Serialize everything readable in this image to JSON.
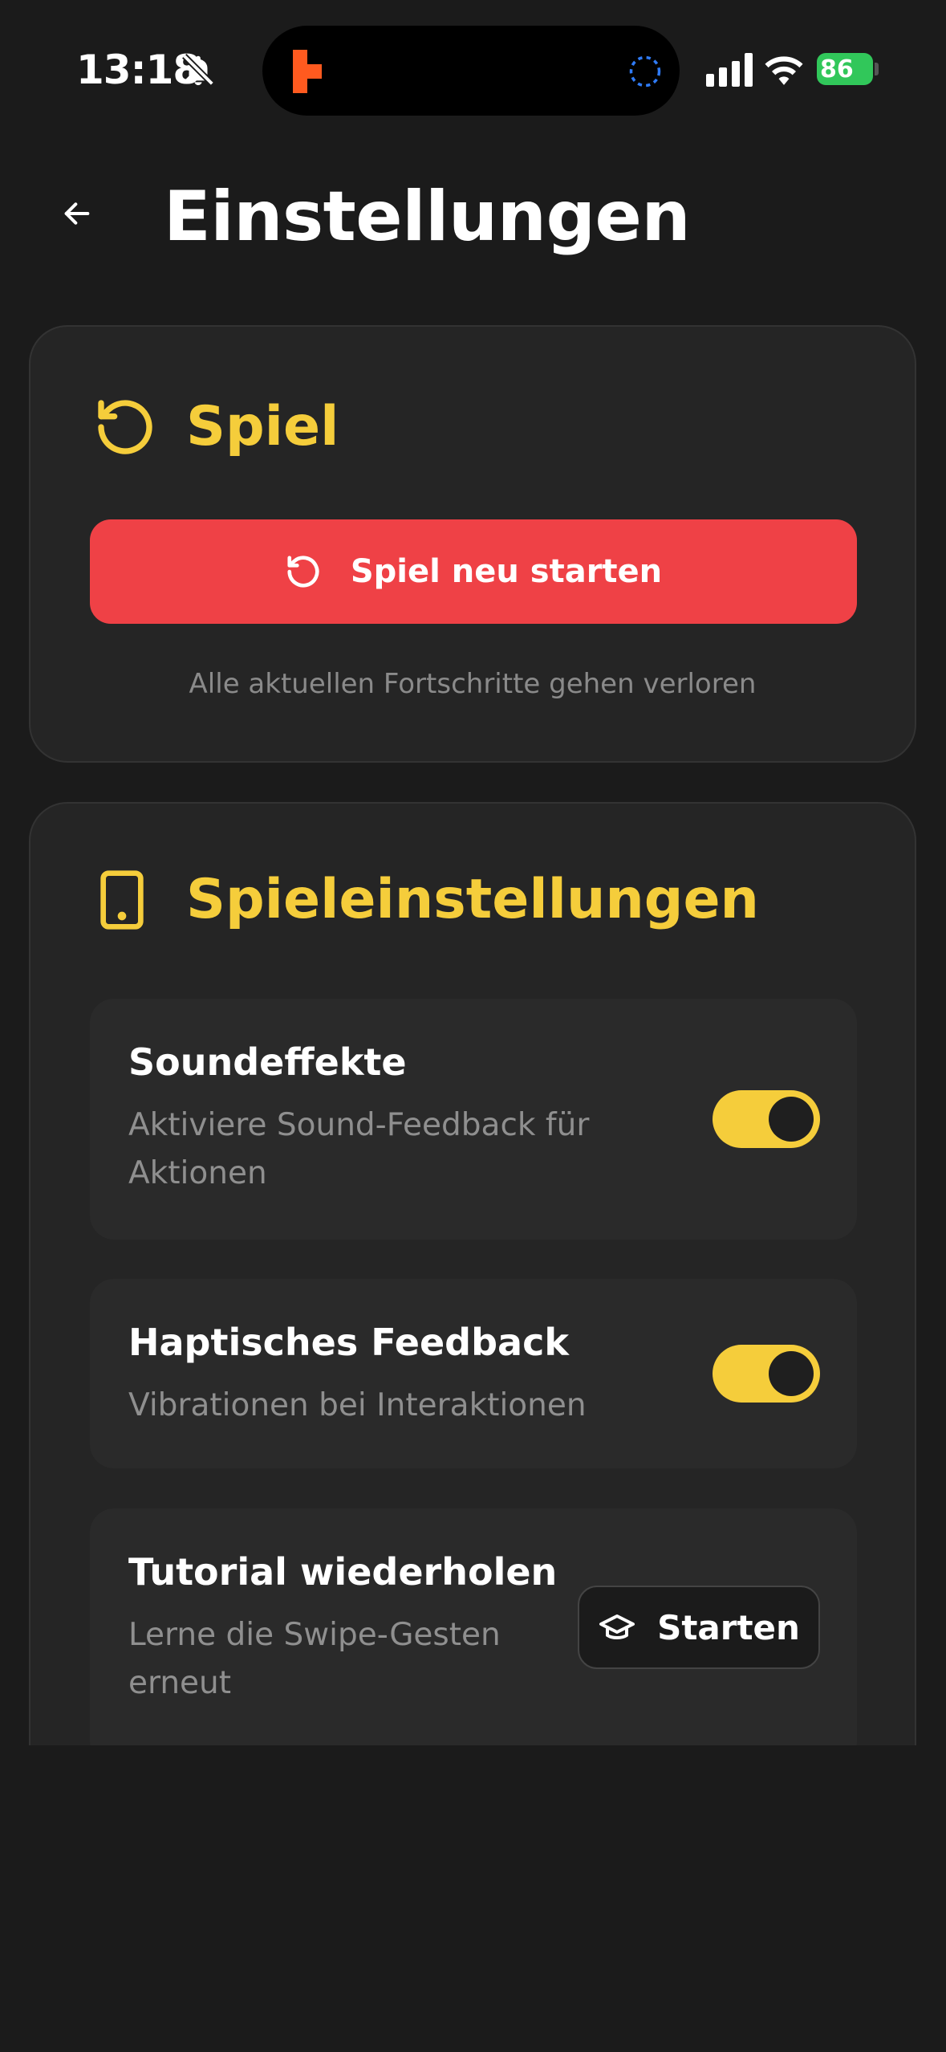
{
  "status_bar": {
    "time": "13:18",
    "battery": "86",
    "icons": [
      "bell-slash-icon",
      "app-activity-icon",
      "loading-spinner-icon",
      "signal-icon",
      "wifi-icon",
      "battery-charging-icon"
    ]
  },
  "header": {
    "title": "Einstellungen",
    "back_icon": "arrow-left-icon"
  },
  "game_section": {
    "title": "Spiel",
    "icon": "rotate-ccw-icon",
    "restart_button_label": "Spiel neu starten",
    "restart_hint": "Alle aktuellen Fortschritte gehen verloren"
  },
  "settings_section": {
    "title": "Spieleinstellungen",
    "icon": "smartphone-icon",
    "items": [
      {
        "title": "Soundeffekte",
        "description_lines": [
          "Aktiviere Sound-Feedback für",
          "Aktionen"
        ],
        "enabled": true
      },
      {
        "title": "Haptisches Feedback",
        "description_lines": [
          "Vibrationen bei Interaktionen"
        ],
        "enabled": true
      },
      {
        "title": "Tutorial wiederholen",
        "description_lines": [
          "Lerne die Swipe-Gesten",
          "erneut"
        ],
        "button_label": "Starten",
        "button_icon": "graduation-cap-icon"
      }
    ]
  },
  "colors": {
    "background": "#1b1b1b",
    "card": "#252525",
    "accent": "#f5cd3b",
    "danger": "#ef4146",
    "muted_text": "#8f8f8f"
  }
}
